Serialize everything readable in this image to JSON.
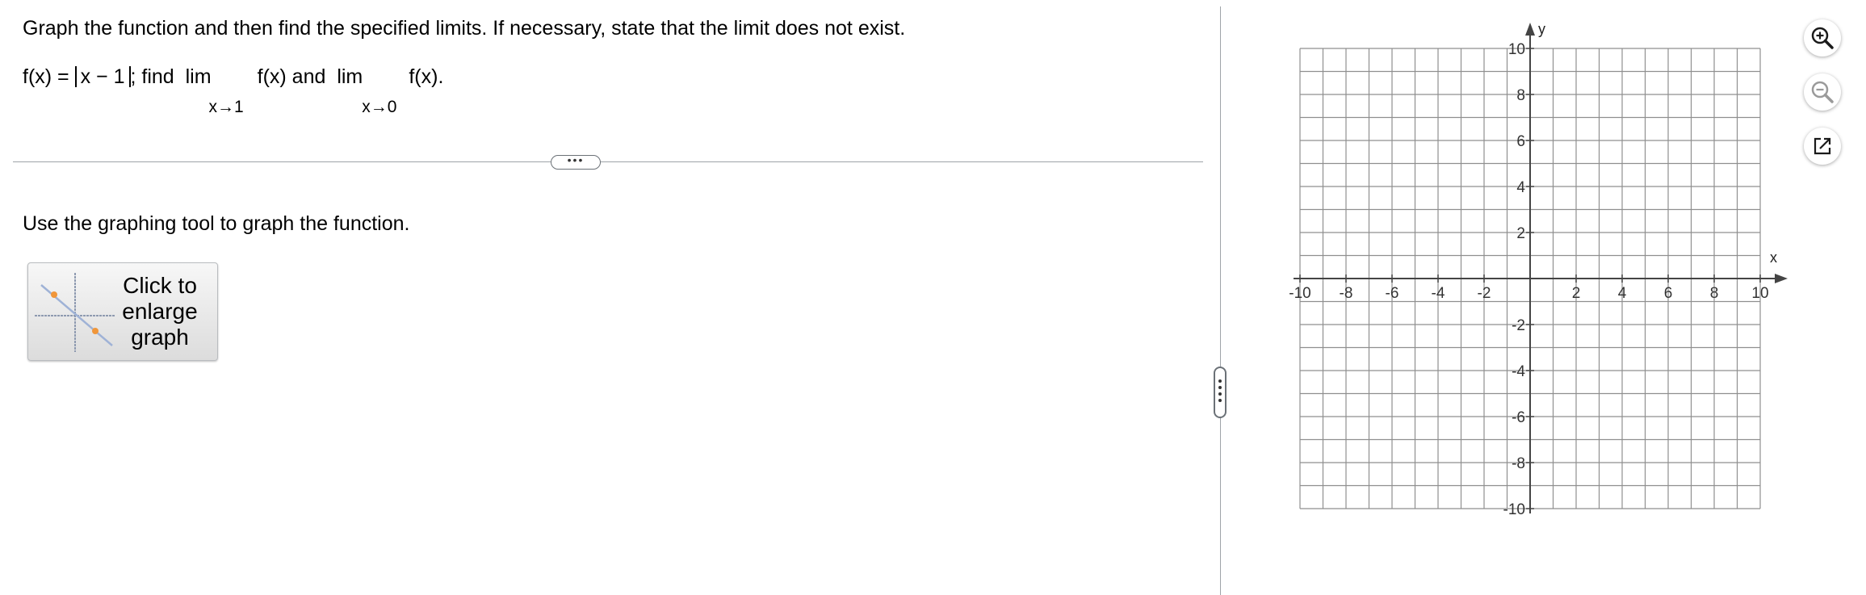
{
  "instruction": "Graph the function and then find the specified limits. If necessary, state that the limit does not exist.",
  "function_line": {
    "lhs": "f(x) = ",
    "abs_body": "x − 1",
    "find_text": "; find",
    "lim1": "lim",
    "lim1_fx": "f(x) and",
    "lim1_sub": "x→1",
    "lim2": "lim",
    "lim2_fx": "f(x).",
    "lim2_sub": "x→0"
  },
  "expand_pill": "•••",
  "graph_prompt": "Use the graphing tool to graph the function.",
  "enlarge_button": {
    "label": "Click to enlarge graph"
  },
  "graph": {
    "x_axis_label": "x",
    "y_axis_label": "y",
    "x_ticks": [
      "-10",
      "-8",
      "-6",
      "-4",
      "-2",
      "2",
      "4",
      "6",
      "8",
      "10"
    ],
    "y_ticks": [
      "10",
      "8",
      "6",
      "4",
      "2",
      "-2",
      "-4",
      "-6",
      "-8",
      "-10"
    ],
    "range": {
      "xmin": -10,
      "xmax": 10,
      "ymin": -10,
      "ymax": 10
    },
    "grid": true
  },
  "tools": {
    "zoom_in_icon": "zoom-in-icon",
    "zoom_out_icon": "zoom-out-icon",
    "popout_icon": "external-link-icon",
    "accent_color": "#1a1a1a",
    "inactive_color": "#9a9a9a"
  }
}
